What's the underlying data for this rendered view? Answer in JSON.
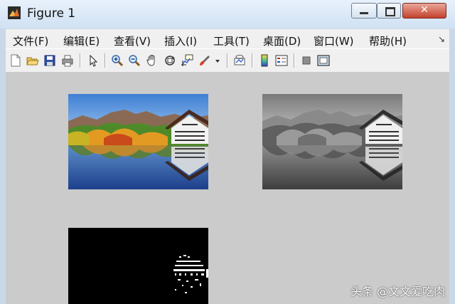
{
  "window": {
    "title": "Figure 1",
    "close_glyph": "✕"
  },
  "menu": [
    {
      "label": "文件(F)"
    },
    {
      "label": "编辑(E)"
    },
    {
      "label": "查看(V)"
    },
    {
      "label": "插入(I)"
    },
    {
      "label": "工具(T)"
    },
    {
      "label": "桌面(D)"
    },
    {
      "label": "窗口(W)"
    },
    {
      "label": "帮助(H)"
    }
  ],
  "menu_overflow_glyph": "↘",
  "toolbar": {
    "icons": [
      "new-figure-icon",
      "open-file-icon",
      "save-icon",
      "print-icon",
      "pointer-icon",
      "zoom-in-icon",
      "zoom-out-icon",
      "pan-icon",
      "rotate-3d-icon",
      "data-cursor-icon",
      "brush-icon",
      "brush-dropdown-icon",
      "link-plot-icon",
      "colorbar-icon",
      "legend-icon",
      "hide-plot-tools-icon",
      "show-plot-tools-icon"
    ]
  },
  "figure": {
    "panels": [
      "color-image",
      "grayscale-image",
      "binary-image"
    ]
  },
  "watermark": "头条 @文文爱吃肉",
  "colors": {
    "close_red": "#c4412d",
    "canvas_gray": "#cbcbcb",
    "toolbar_bg": "#f0f0f0"
  }
}
